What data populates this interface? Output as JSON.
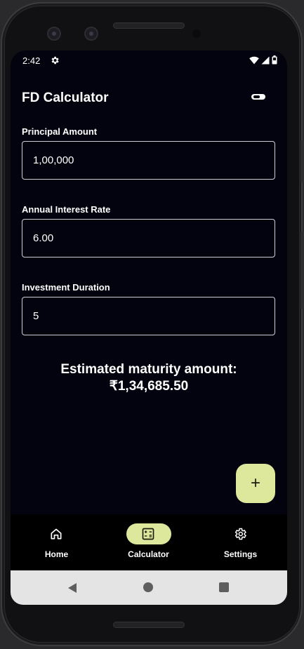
{
  "status_bar": {
    "time": "2:42",
    "icons": [
      "gear-icon",
      "wifi-icon",
      "cellular-signal-icon",
      "battery-icon"
    ]
  },
  "app_bar": {
    "title": "FD Calculator",
    "theme_toggle_icon": "toggle-icon"
  },
  "form": {
    "principal": {
      "label": "Principal Amount",
      "value": "1,00,000"
    },
    "rate": {
      "label": "Annual Interest Rate",
      "value": "6.00"
    },
    "duration": {
      "label": "Investment Duration",
      "value": "5"
    }
  },
  "result": {
    "label": "Estimated maturity amount:",
    "amount": "₹1,34,685.50"
  },
  "fab": {
    "label": "+",
    "icon": "plus-icon"
  },
  "bottom_nav": {
    "items": [
      {
        "label": "Home",
        "icon": "home-icon",
        "active": false
      },
      {
        "label": "Calculator",
        "icon": "calculator-icon",
        "active": true
      },
      {
        "label": "Settings",
        "icon": "settings-icon",
        "active": false
      }
    ]
  },
  "system_nav": {
    "icons": [
      "back-icon",
      "home-circle-icon",
      "recents-icon"
    ]
  },
  "colors": {
    "background": "#03030f",
    "accent": "#dde89d",
    "nav_background": "#000000",
    "system_nav_background": "#e4e4e4"
  }
}
